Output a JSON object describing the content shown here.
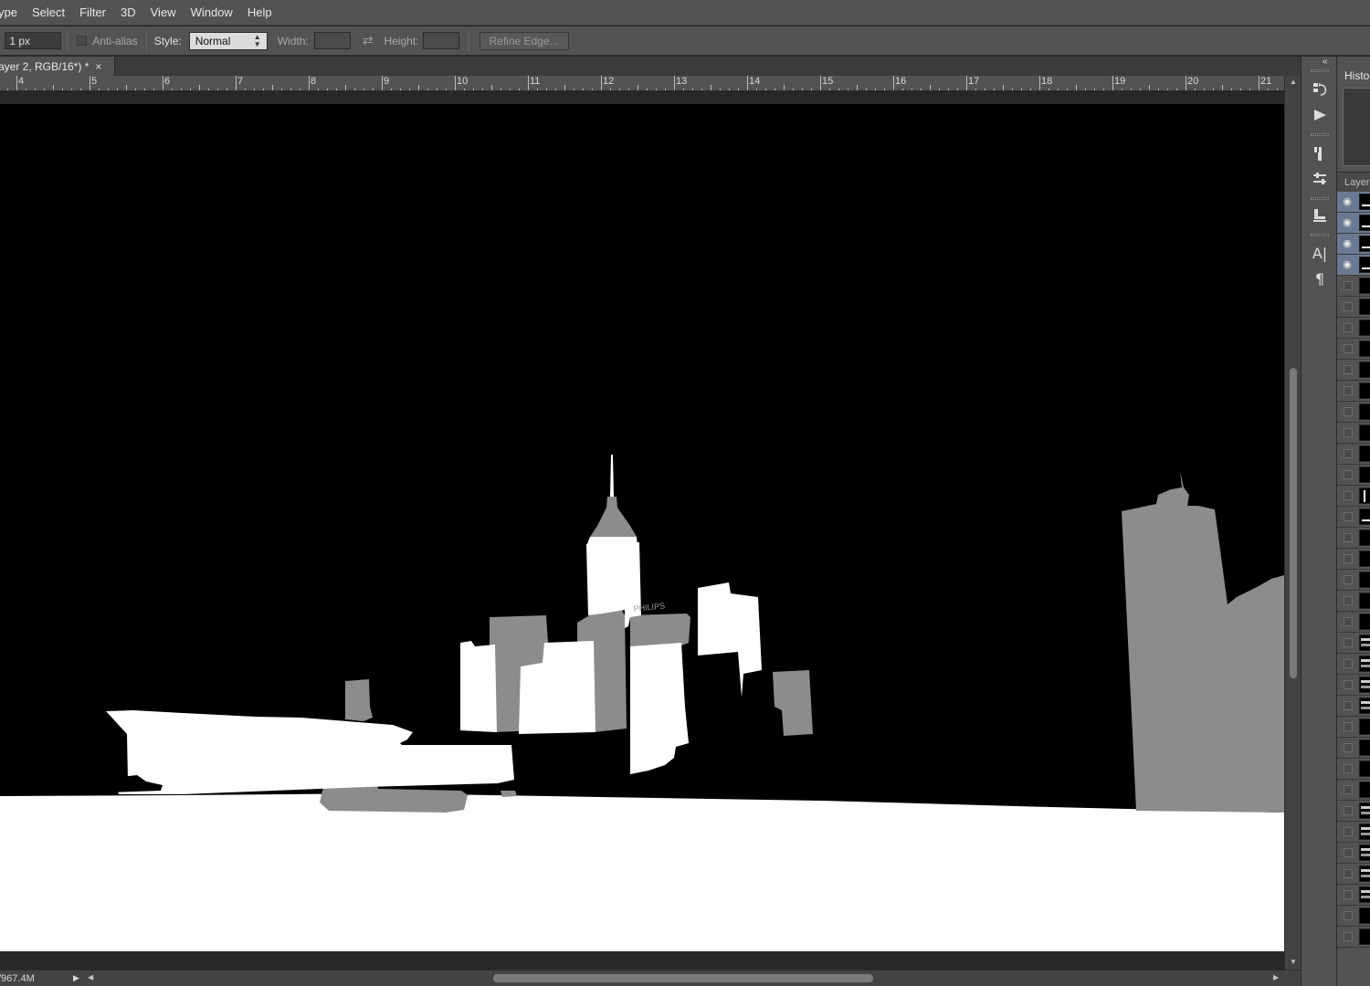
{
  "menu": {
    "items": [
      "ype",
      "Select",
      "Filter",
      "3D",
      "View",
      "Window",
      "Help"
    ]
  },
  "options": {
    "feather_value": "1 px",
    "antialias_label": "Anti-alias",
    "style_label": "Style:",
    "style_value": "Normal",
    "width_label": "Width:",
    "height_label": "Height:",
    "refine_label": "Refine Edge...",
    "swap_icon": "swap-arrows-icon"
  },
  "document": {
    "tab_title": "ayer 2, RGB/16*) *",
    "close_label": "×"
  },
  "ruler": {
    "labels": [
      "4",
      "5",
      "6",
      "7",
      "8",
      "9",
      "10",
      "11",
      "12",
      "13",
      "14",
      "15",
      "16",
      "17",
      "18",
      "19",
      "20",
      "21"
    ]
  },
  "artwork": {
    "sign_text": "PHILIPS"
  },
  "status": {
    "doc_size": "/967.4M",
    "menu_arrow": "▶"
  },
  "panels": {
    "history_tab": "Histo",
    "layers_tab": "Layer",
    "icons": [
      "history-icon",
      "play-action-icon",
      "brush-presets-icon",
      "adjustments-icon",
      "clone-source-icon",
      "character-icon",
      "paragraph-icon"
    ],
    "layer_rows": [
      {
        "visible": true,
        "selected": true,
        "thumb": "white-line"
      },
      {
        "visible": true,
        "selected": true,
        "thumb": "white-line"
      },
      {
        "visible": true,
        "selected": true,
        "thumb": "white-line"
      },
      {
        "visible": true,
        "selected": true,
        "thumb": "white-line"
      },
      {
        "visible": false,
        "selected": false,
        "thumb": "black"
      },
      {
        "visible": false,
        "selected": false,
        "thumb": "black"
      },
      {
        "visible": false,
        "selected": false,
        "thumb": "black"
      },
      {
        "visible": false,
        "selected": false,
        "thumb": "black"
      },
      {
        "visible": false,
        "selected": false,
        "thumb": "black"
      },
      {
        "visible": false,
        "selected": false,
        "thumb": "black"
      },
      {
        "visible": false,
        "selected": false,
        "thumb": "black"
      },
      {
        "visible": false,
        "selected": false,
        "thumb": "black"
      },
      {
        "visible": false,
        "selected": false,
        "thumb": "black"
      },
      {
        "visible": false,
        "selected": false,
        "thumb": "black"
      },
      {
        "visible": false,
        "selected": false,
        "thumb": "vertical"
      },
      {
        "visible": false,
        "selected": false,
        "thumb": "white-line"
      },
      {
        "visible": false,
        "selected": false,
        "thumb": "black"
      },
      {
        "visible": false,
        "selected": false,
        "thumb": "black"
      },
      {
        "visible": false,
        "selected": false,
        "thumb": "black"
      },
      {
        "visible": false,
        "selected": false,
        "thumb": "black"
      },
      {
        "visible": false,
        "selected": false,
        "thumb": "black"
      },
      {
        "visible": false,
        "selected": false,
        "thumb": "grey-lines"
      },
      {
        "visible": false,
        "selected": false,
        "thumb": "grey-lines"
      },
      {
        "visible": false,
        "selected": false,
        "thumb": "grey-lines"
      },
      {
        "visible": false,
        "selected": false,
        "thumb": "grey-lines"
      },
      {
        "visible": false,
        "selected": false,
        "thumb": "black"
      },
      {
        "visible": false,
        "selected": false,
        "thumb": "black"
      },
      {
        "visible": false,
        "selected": false,
        "thumb": "black"
      },
      {
        "visible": false,
        "selected": false,
        "thumb": "black"
      },
      {
        "visible": false,
        "selected": false,
        "thumb": "grey-lines"
      },
      {
        "visible": false,
        "selected": false,
        "thumb": "grey-lines"
      },
      {
        "visible": false,
        "selected": false,
        "thumb": "grey-lines"
      },
      {
        "visible": false,
        "selected": false,
        "thumb": "grey-lines"
      },
      {
        "visible": false,
        "selected": false,
        "thumb": "grey-lines"
      },
      {
        "visible": false,
        "selected": false,
        "thumb": "black"
      },
      {
        "visible": false,
        "selected": false,
        "thumb": "black"
      }
    ]
  },
  "colors": {
    "ui_panel": "#535353",
    "ui_dark": "#282828",
    "layer_selected": "#6b7a92",
    "mask_grey": "#8c8c8c",
    "mask_white": "#ffffff"
  }
}
